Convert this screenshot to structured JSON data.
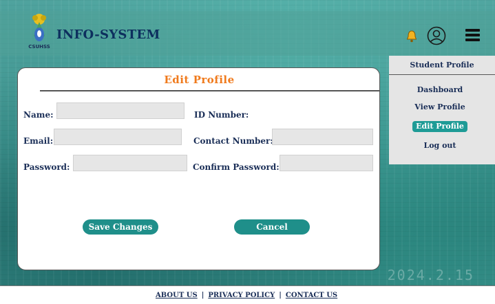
{
  "app": {
    "brand": "INFO-SYSTEM",
    "logo_text": "CSUHSS"
  },
  "background": {
    "stamp_text": "2024.2.15"
  },
  "header": {
    "icons": [
      "bell-icon",
      "user-icon",
      "hamburger-menu-icon"
    ]
  },
  "sidebar": {
    "title": "Student Profile",
    "items": [
      {
        "label": "Dashboard",
        "active": false
      },
      {
        "label": "View Profile",
        "active": false
      },
      {
        "label": "Edit Profile",
        "active": true
      },
      {
        "label": "Log out",
        "active": false
      }
    ]
  },
  "form": {
    "title": "Edit  Profile",
    "fields": {
      "name": {
        "label": "Name:",
        "value": ""
      },
      "id_number": {
        "label": "ID Number:",
        "value": ""
      },
      "email": {
        "label": "Email:",
        "value": ""
      },
      "contact_number": {
        "label": "Contact Number:",
        "value": ""
      },
      "password": {
        "label": "Password:",
        "value": ""
      },
      "confirm_password": {
        "label": "Confirm Password:",
        "value": ""
      }
    },
    "buttons": {
      "save": "Save Changes",
      "cancel": "Cancel"
    }
  },
  "footer": {
    "about": "ABOUT US",
    "sep1": "|",
    "privacy": "PRIVACY POLICY",
    "sep2": "|",
    "contact": "CONTACT US"
  },
  "colors": {
    "accent": "#1f8f8a",
    "title_orange": "#f07a1c",
    "text_navy": "#1a2e57"
  }
}
